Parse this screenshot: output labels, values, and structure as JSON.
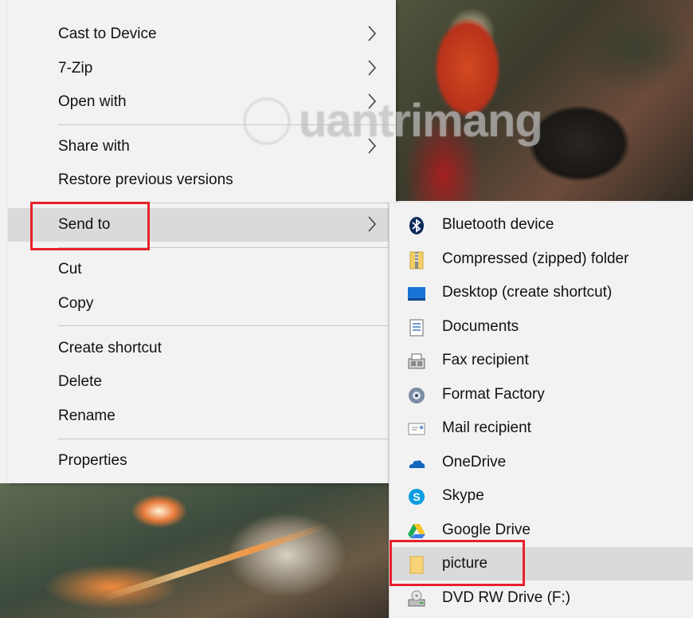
{
  "menu": {
    "items": [
      {
        "label": "Cast to Device",
        "submenu": true
      },
      {
        "label": "7-Zip",
        "submenu": true
      },
      {
        "label": "Open with",
        "submenu": true
      },
      {
        "label": "Share with",
        "submenu": true
      },
      {
        "label": "Restore previous versions",
        "submenu": false
      },
      {
        "label": "Send to",
        "submenu": true
      },
      {
        "label": "Cut",
        "submenu": false
      },
      {
        "label": "Copy",
        "submenu": false
      },
      {
        "label": "Create shortcut",
        "submenu": false
      },
      {
        "label": "Delete",
        "submenu": false
      },
      {
        "label": "Rename",
        "submenu": false
      },
      {
        "label": "Properties",
        "submenu": false
      }
    ]
  },
  "send_to": {
    "items": [
      {
        "label": "Bluetooth device",
        "icon": "bluetooth-icon"
      },
      {
        "label": "Compressed (zipped) folder",
        "icon": "zip-folder-icon"
      },
      {
        "label": "Desktop (create shortcut)",
        "icon": "desktop-icon"
      },
      {
        "label": "Documents",
        "icon": "documents-icon"
      },
      {
        "label": "Fax recipient",
        "icon": "fax-icon"
      },
      {
        "label": "Format Factory",
        "icon": "format-factory-icon"
      },
      {
        "label": "Mail recipient",
        "icon": "mail-icon"
      },
      {
        "label": "OneDrive",
        "icon": "onedrive-icon"
      },
      {
        "label": "Skype",
        "icon": "skype-icon"
      },
      {
        "label": "Google Drive",
        "icon": "google-drive-icon"
      },
      {
        "label": "picture",
        "icon": "folder-icon"
      },
      {
        "label": "DVD RW Drive (F:)",
        "icon": "dvd-drive-icon"
      }
    ]
  },
  "watermark": {
    "text": "uantrimang"
  },
  "colors": {
    "highlight": "#e8212b",
    "menu_bg": "#f2f2f2",
    "hover_bg": "#dadada"
  }
}
